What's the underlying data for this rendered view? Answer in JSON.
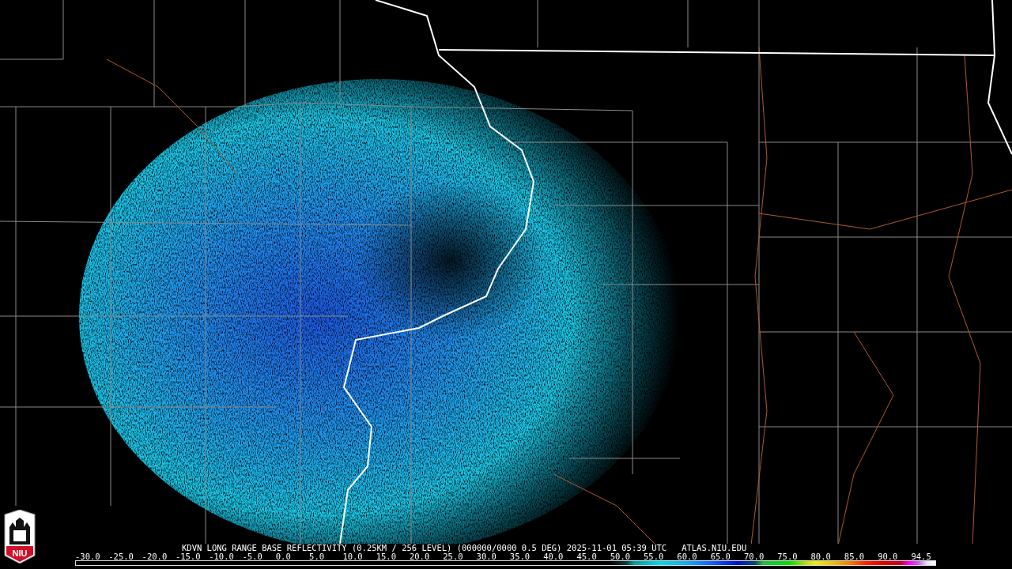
{
  "logo": {
    "text": "NIU"
  },
  "product_title": "KDVN LONG RANGE BASE REFLECTIVITY (0.25KM / 256 LEVEL) (000000/0000 0.5 DEG) 2025-11-01 05:39 UTC   ATLAS.NIU.EDU",
  "legend": {
    "labels": [
      "-30.0",
      "-25.0",
      "-20.0",
      "-15.0",
      "-10.0",
      "-5.0",
      "0.0",
      "5.0",
      "10.0",
      "15.0",
      "20.0",
      "25.0",
      "30.0",
      "35.0",
      "40.0",
      "45.0",
      "50.0",
      "55.0",
      "60.0",
      "65.0",
      "70.0",
      "75.0",
      "80.0",
      "85.0",
      "90.0",
      "94.5"
    ]
  }
}
